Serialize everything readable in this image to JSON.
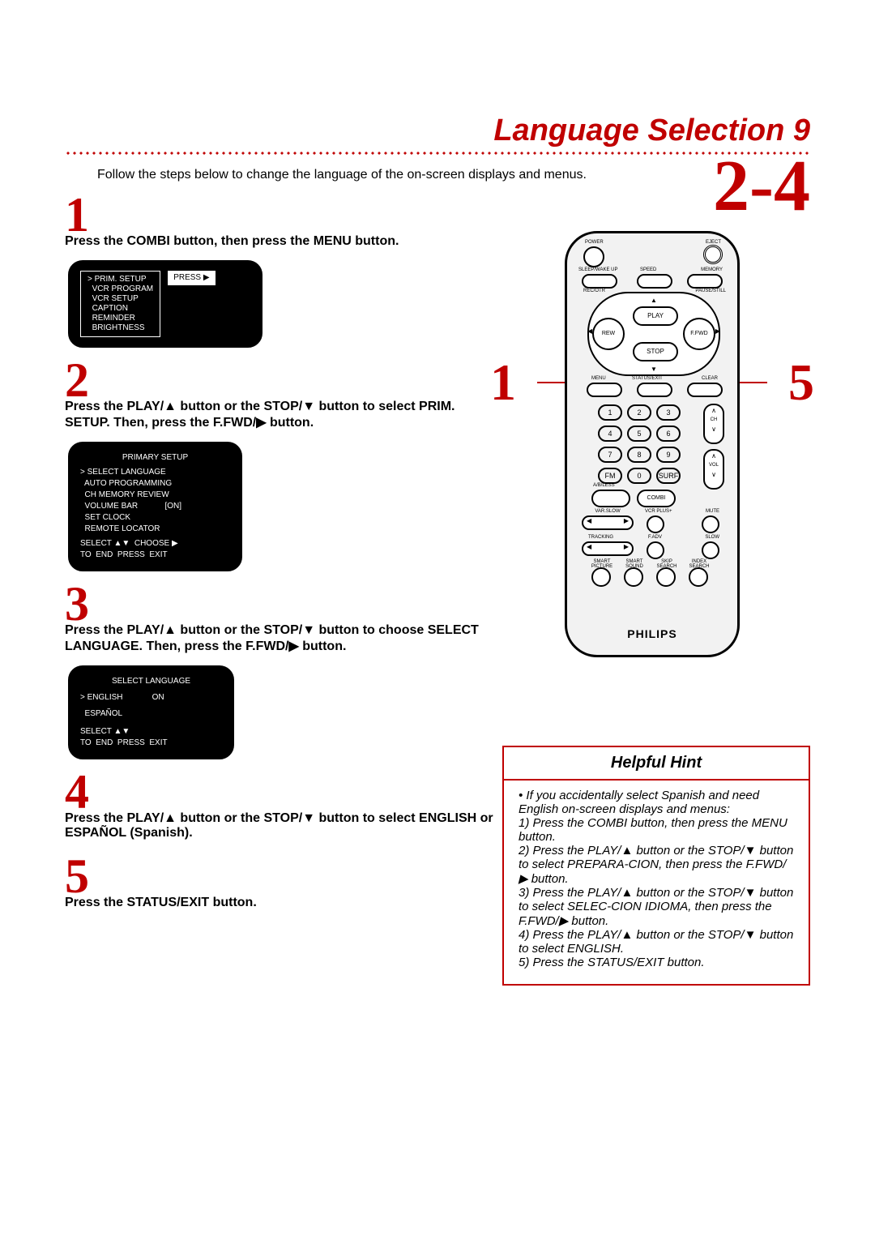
{
  "title": "Language Selection  9",
  "intro": "Follow the steps below to change the language of the on-screen displays and menus.",
  "range_label": "2-4",
  "steps": {
    "s1": {
      "num": "1",
      "text": "Press the COMBI button, then press the MENU button."
    },
    "s2": {
      "num": "2",
      "text": "Press the PLAY/▲ button or the STOP/▼ button to select PRIM. SETUP. Then, press the F.FWD/▶ button."
    },
    "s3": {
      "num": "3",
      "text": "Press the PLAY/▲ button or the STOP/▼ button to choose SELECT LANGUAGE. Then, press the F.FWD/▶ button."
    },
    "s4": {
      "num": "4",
      "text": "Press the PLAY/▲ button or the STOP/▼ button to select ENGLISH or ESPAÑOL (Spanish)."
    },
    "s5": {
      "num": "5",
      "text": "Press the STATUS/EXIT button."
    }
  },
  "osd1": {
    "items": [
      "PRIM. SETUP",
      "VCR PROGRAM",
      "VCR SETUP",
      "CAPTION",
      "REMINDER",
      "BRIGHTNESS"
    ],
    "marker": ">",
    "press": "PRESS ▶"
  },
  "osd2": {
    "header": "PRIMARY SETUP",
    "items": [
      "> SELECT LANGUAGE",
      "  AUTO PROGRAMMING",
      "  CH MEMORY REVIEW",
      "  VOLUME BAR            [ON]",
      "  SET CLOCK",
      "  REMOTE LOCATOR"
    ],
    "footer1": "SELECT ▲▼  CHOOSE ▶",
    "footer2": "TO  END  PRESS  EXIT"
  },
  "osd3": {
    "header": "SELECT LANGUAGE",
    "rows": [
      "> ENGLISH             ON",
      "  ESPAÑOL"
    ],
    "footer1": "SELECT ▲▼",
    "footer2": "TO  END  PRESS  EXIT"
  },
  "callouts": {
    "left": "1",
    "right": "5"
  },
  "remote": {
    "power": "POWER",
    "eject": "EJECT",
    "sleep": "SLEEP/WAKE UP",
    "speed": "SPEED",
    "memory": "MEMORY",
    "recotr": "REC/OTR",
    "pause": "PAUSE/STILL",
    "play": "PLAY",
    "stop": "STOP",
    "rew": "REW",
    "ffwd": "F.FWD",
    "menu": "MENU",
    "status": "STATUS/EXIT",
    "clear": "CLEAR",
    "ch": "CH",
    "vol": "VOL",
    "fm": "FM",
    "surf": "SURF",
    "combi": "COMBI",
    "arless": "A/B/LESS",
    "varslow": "VAR.SLOW",
    "vcrplus": "VCR PLUS+",
    "mute": "MUTE",
    "tracking": "TRACKING",
    "fadv": "F.ADV",
    "slow": "SLOW",
    "smart_picture": "SMART PICTURE",
    "smart_sound": "SMART SOUND",
    "skip_search": "SKIP SEARCH",
    "index_search": "INDEX SEARCH",
    "brand": "PHILIPS",
    "numbers": [
      "1",
      "2",
      "3",
      "4",
      "5",
      "6",
      "7",
      "8",
      "9",
      "0"
    ]
  },
  "hint": {
    "title": "Helpful Hint",
    "body": "• If you accidentally select Spanish and need English on-screen displays and menus:\n1) Press the COMBI button, then press the MENU button.\n2) Press the PLAY/▲ button or the STOP/▼ button to select PREPARA-CION, then press the F.FWD/▶ button.\n3) Press the PLAY/▲ button or the STOP/▼ button to select SELEC-CION IDIOMA, then press the F.FWD/▶ button.\n4) Press the PLAY/▲ button or the STOP/▼ button to select ENGLISH.\n5) Press the STATUS/EXIT button."
  }
}
